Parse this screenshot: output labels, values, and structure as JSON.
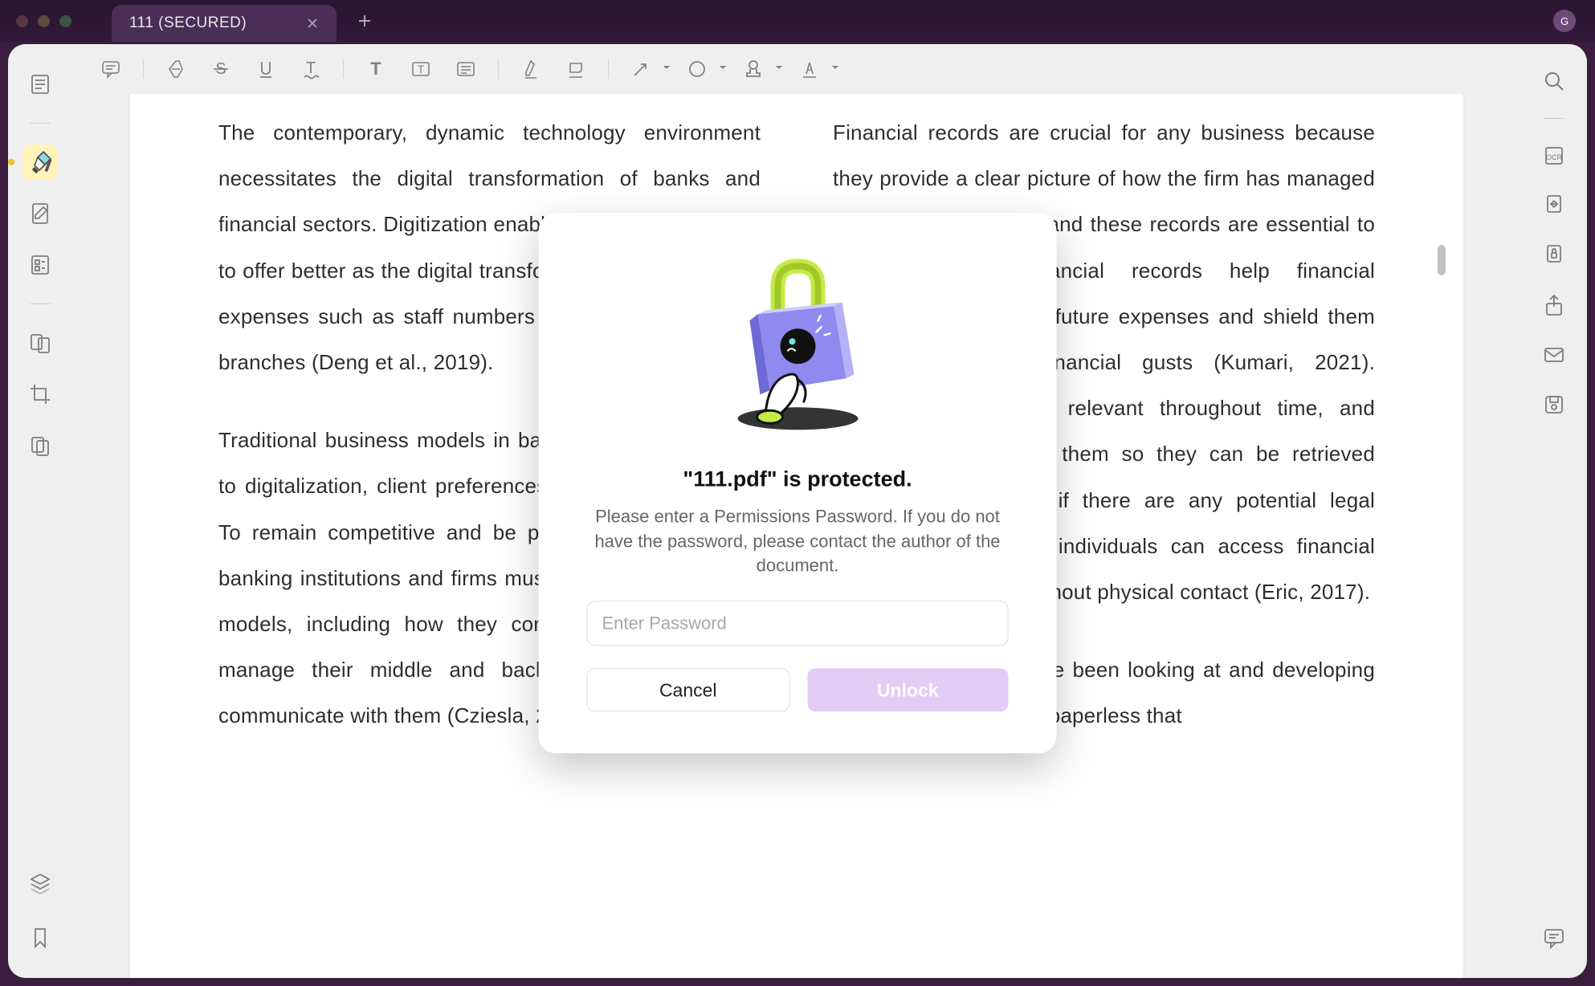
{
  "window": {
    "tab_title": "111 (SECURED)"
  },
  "sidebar_left_icons": {
    "view": "view-icon",
    "highlight": "highlighter-icon",
    "annotate": "annotate-icon",
    "form": "form-icon",
    "compare": "compare-icon",
    "crop": "crop-icon",
    "pages": "pages-icon",
    "layers": "layers-icon",
    "bookmark": "bookmark-icon"
  },
  "toolbar_icons": {
    "comment": "comment-icon",
    "eraser": "eraser-icon",
    "strike": "strikethrough-icon",
    "underline": "underline-icon",
    "squiggly": "squiggly-underline-icon",
    "textedit": "text-tool-icon",
    "textbox": "text-box-icon",
    "align": "align-icon",
    "marker": "marker-icon",
    "areah": "area-highlight-icon",
    "arrow": "arrow-icon",
    "shape": "shape-icon",
    "stamp": "stamp-icon",
    "sign": "signature-icon"
  },
  "right_rail_icons": {
    "search": "search-icon",
    "ocr": "ocr-icon",
    "convert": "convert-icon",
    "secure": "secure-icon",
    "share": "share-icon",
    "mail": "mail-icon",
    "save": "save-icon",
    "chat": "chat-icon"
  },
  "document": {
    "left_para1": "The contemporary, dynamic technology environment necessitates the digital transformation of banks and financial sectors. Digitization enables banking businesses to offer better as the digital transformation helps them cut expenses such as staff numbers and physically present branches (Deng et al., 2019).",
    "left_para2": "Traditional business models in banking are evolving due to digitalization, client preferences, and new technology. To remain competitive and be prepared for the future, banking institutions and firms must modify their business models, including how they connect with consumers, manage their middle and back-office activities, and communicate with them (Cziesla, 2014). It would lower",
    "right_para1": "Financial records are crucial for any business because they provide a clear picture of how the firm has managed its financial resources and these records are essential to decision-making. Financial records help financial companies to plan for future expenses and shield them from unanticipated financial gusts (Kumari, 2021). Financial records are relevant throughout time, and institutions must save them so they can be retrieved afterwards, especially if there are any potential legal difficulties. Authorized individuals can access financial information anytime without physical contact (Eric, 2017).",
    "right_para2": "Commercial banks have been looking at and developing methods for becoming paperless that"
  },
  "modal": {
    "title": "\"111.pdf\" is protected.",
    "body": "Please enter a Permissions Password. If you do not have the password, please contact the author of the document.",
    "placeholder": "Enter Password",
    "cancel": "Cancel",
    "unlock": "Unlock"
  },
  "colors": {
    "accent": "#e3ccf5",
    "highlight_tool": "#fff2b0"
  }
}
